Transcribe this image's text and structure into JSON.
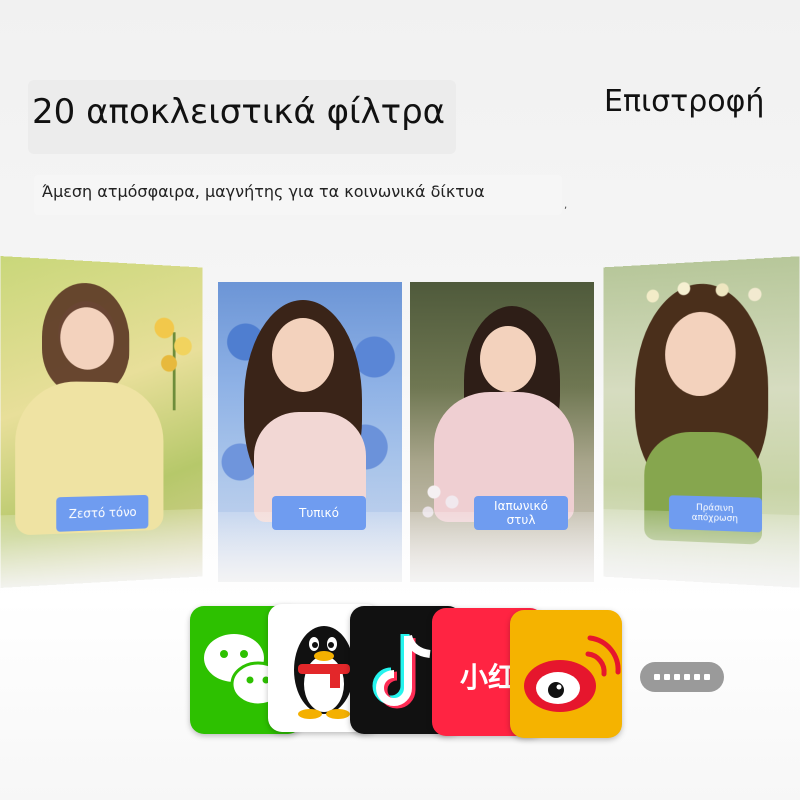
{
  "header": {
    "title": "20 αποκλειστικά φίλτρα",
    "back_label": "Επιστροφή",
    "subtitle": "Άμεση ατμόσφαιρα, μαγνήτης για τα κοινωνικά δίκτυα",
    "subtitle_mark": ","
  },
  "filters": [
    {
      "label": "Ζεστό τόνο",
      "color": "#e9d98a"
    },
    {
      "label": "Τυπικό",
      "color": "#7fa6e0"
    },
    {
      "label": "Ιαπωνικό στυλ",
      "color": "#e7c2c8"
    },
    {
      "label": "Πράσινη απόχρωση",
      "color": "#9dbf6a"
    }
  ],
  "filter_label_color": "#6f9cf0",
  "share_apps": [
    {
      "icon": "wechat-icon",
      "color": "#2dc100"
    },
    {
      "icon": "qq-penguin-icon",
      "color": "#ffffff"
    },
    {
      "icon": "tiktok-icon",
      "color": "#111111"
    },
    {
      "icon": "xiaohongshu-icon",
      "color": "#ff2442",
      "text": "小红"
    },
    {
      "icon": "weibo-icon",
      "color": "#f5b300"
    }
  ],
  "more_button_icon": "more-dots-icon"
}
